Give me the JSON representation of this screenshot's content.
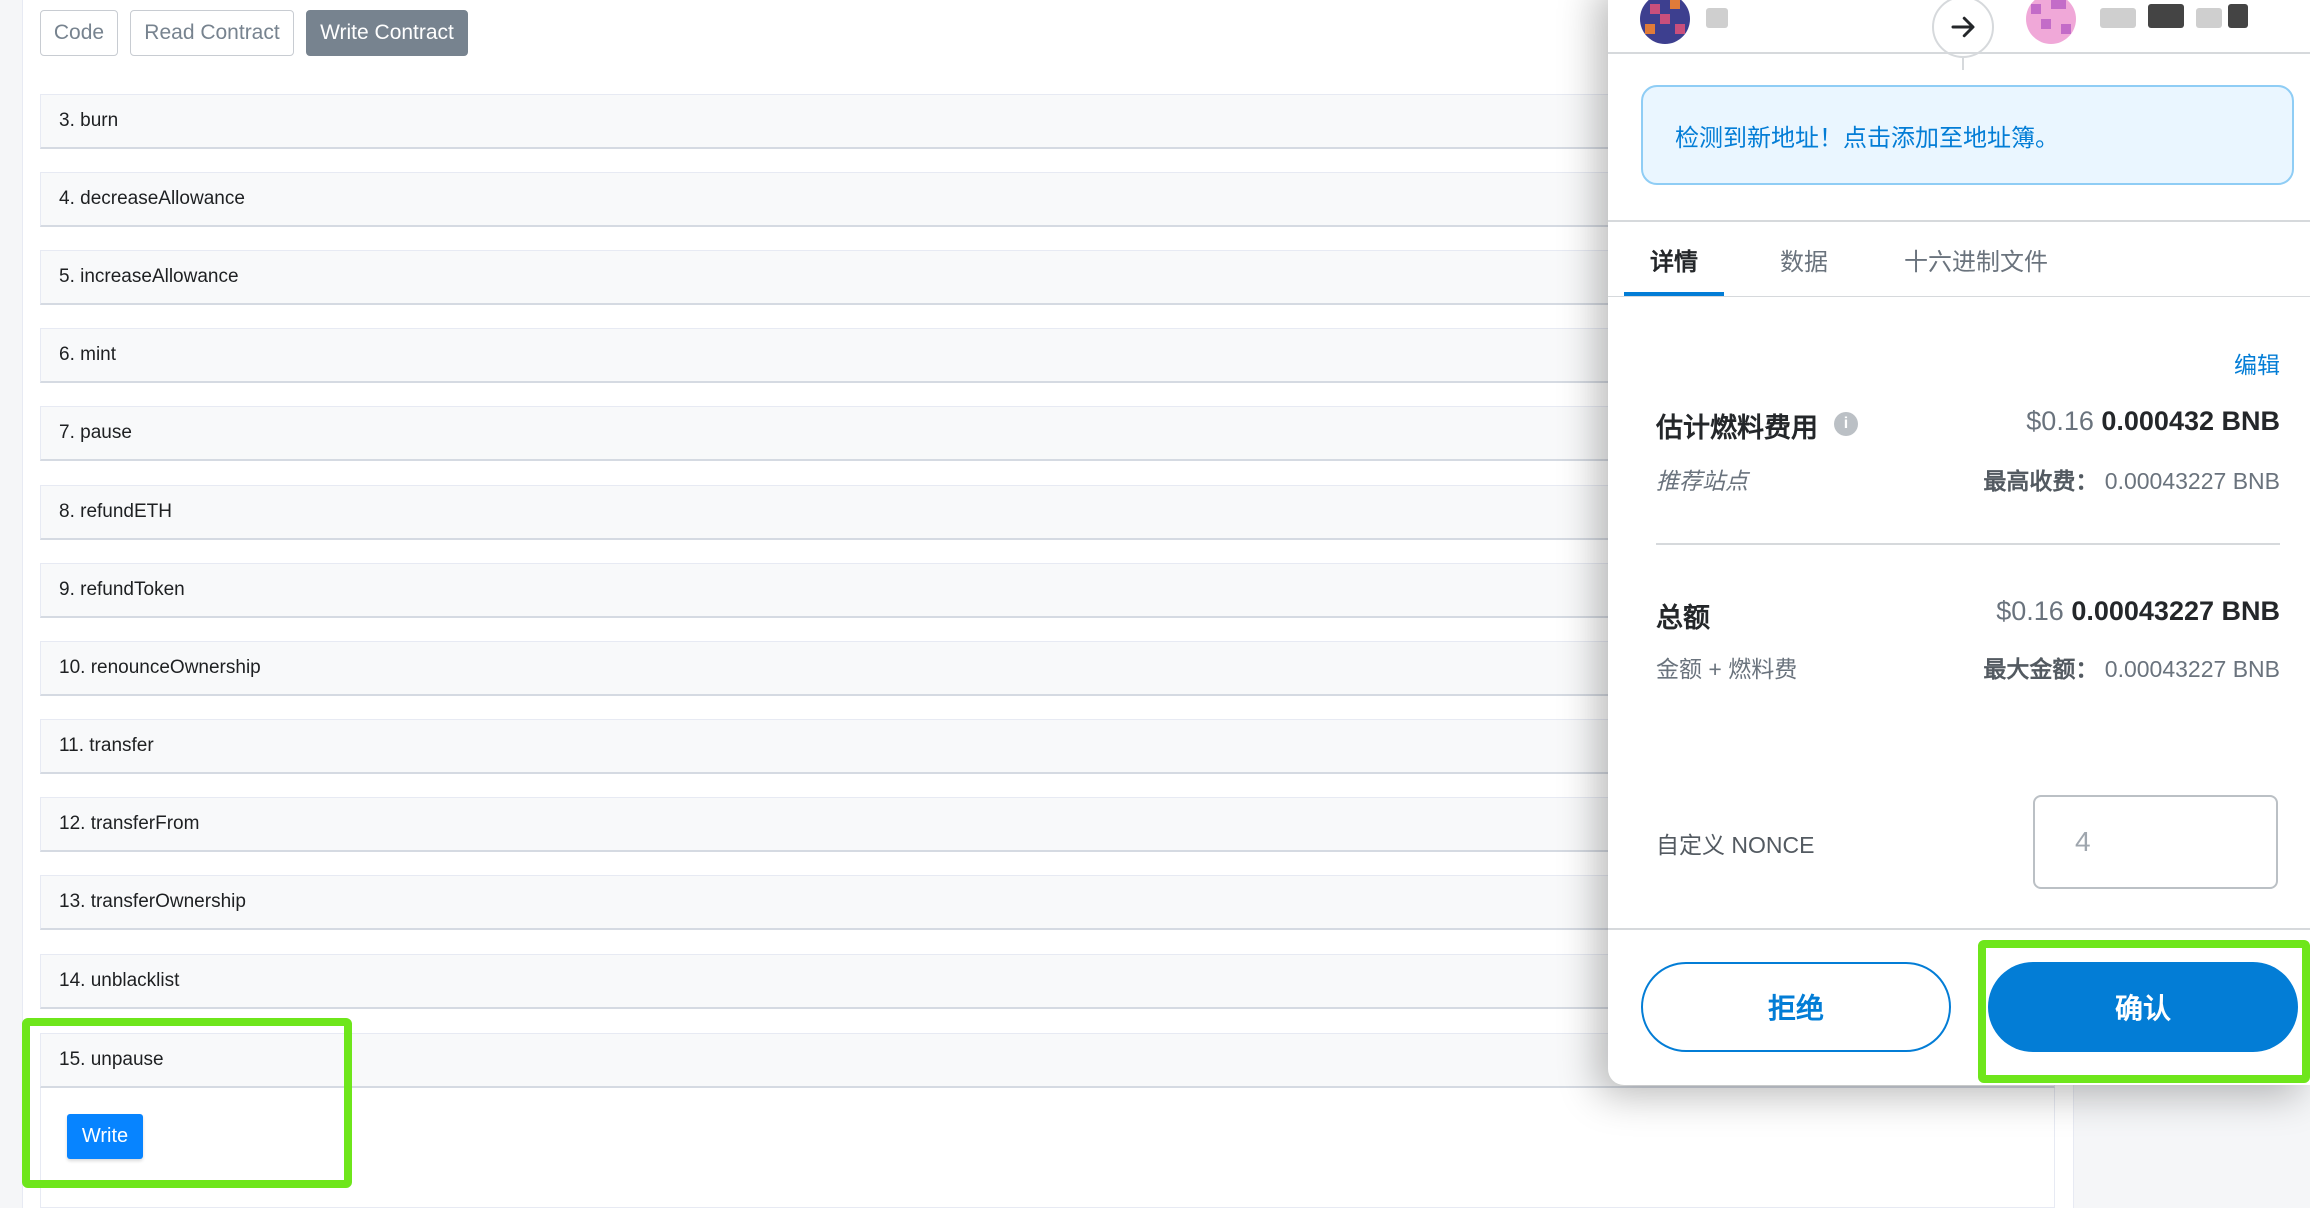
{
  "contract_tabs": {
    "code": "Code",
    "read": "Read Contract",
    "write": "Write Contract"
  },
  "functions": [
    "3. burn",
    "4. decreaseAllowance",
    "5. increaseAllowance",
    "6. mint",
    "7. pause",
    "8. refundETH",
    "9. refundToken",
    "10. renounceOwnership",
    "11. transfer",
    "12. transferFrom",
    "13. transferOwnership",
    "14. unblacklist",
    "15. unpause"
  ],
  "write_button": "Write",
  "popup": {
    "notice": "检测到新地址！点击添加至地址簿。",
    "tabs": {
      "details": "详情",
      "data": "数据",
      "hex": "十六进制文件"
    },
    "edit": "编辑",
    "gas": {
      "label": "估计燃料费用",
      "usd": "$0.16",
      "amount": "0.000432 BNB",
      "sub_label": "推荐站点",
      "max_label": "最高收费：",
      "max_value": "0.00043227 BNB"
    },
    "total": {
      "label": "总额",
      "usd": "$0.16",
      "amount": "0.00043227 BNB",
      "sub_label": "金额 + 燃料费",
      "max_label": "最大金额：",
      "max_value": "0.00043227 BNB"
    },
    "nonce": {
      "label": "自定义 NONCE",
      "placeholder": "4"
    },
    "reject": "拒绝",
    "confirm": "确认"
  },
  "colors": {
    "accent": "#037dd6",
    "highlight": "#6ee61b",
    "write_btn": "#0784ff"
  }
}
